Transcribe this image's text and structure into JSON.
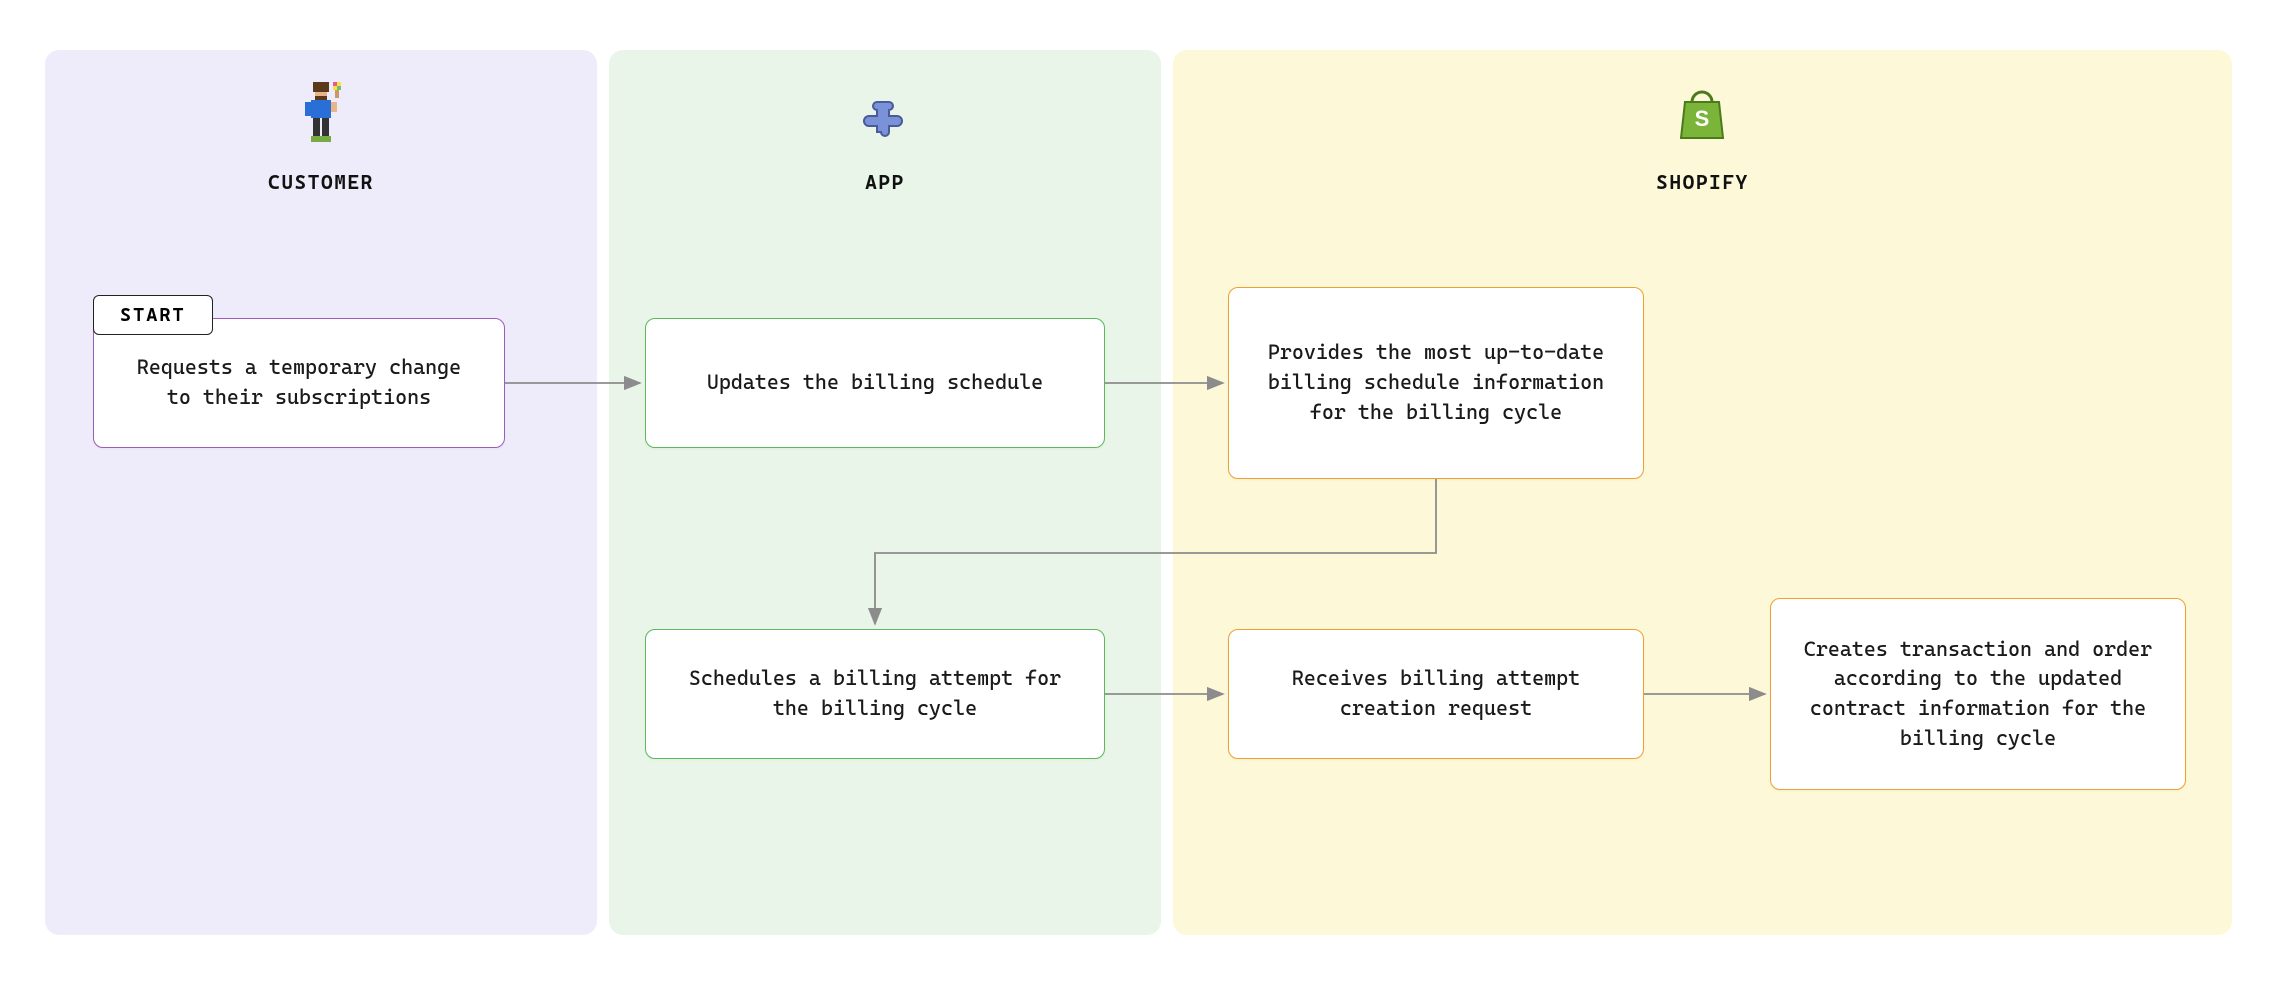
{
  "start_label": "START",
  "lanes": {
    "customer": {
      "title": "CUSTOMER"
    },
    "app": {
      "title": "APP"
    },
    "shopify": {
      "title": "SHOPIFY"
    }
  },
  "boxes": {
    "customer_request": "Requests a temporary change to their subscriptions",
    "app_update": "Updates the billing schedule",
    "shopify_provides": "Provides the most up-to-date billing schedule information for the billing cycle",
    "app_schedules": "Schedules a billing attempt for the billing cycle",
    "shopify_receives": "Receives billing attempt creation request",
    "shopify_creates": "Creates transaction and order according to the updated contract information for the billing cycle"
  }
}
